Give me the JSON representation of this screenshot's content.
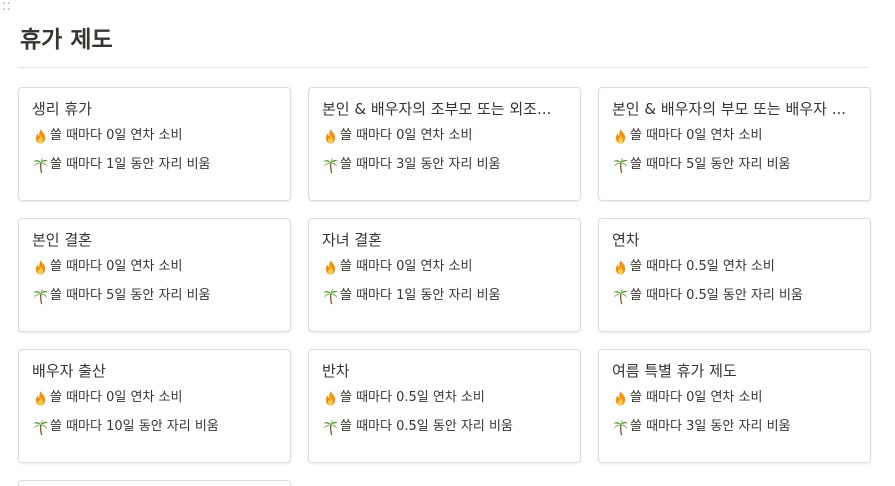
{
  "page": {
    "title": "휴가 제도"
  },
  "icons": {
    "fire": "fire-emoji-icon",
    "palm": "palm-tree-emoji-icon"
  },
  "cards": [
    {
      "title": "생리 휴가",
      "line1": "쓸 때마다 0일 연차 소비",
      "line2": "쓸 때마다 1일 동안 자리 비움"
    },
    {
      "title": "본인 & 배우자의 조부모 또는 외조...",
      "line1": "쓸 때마다 0일 연차 소비",
      "line2": "쓸 때마다 3일 동안 자리 비움"
    },
    {
      "title": "본인 & 배우자의 부모 또는 배우자 ...",
      "line1": "쓸 때마다 0일 연차 소비",
      "line2": "쓸 때마다 5일 동안 자리 비움"
    },
    {
      "title": "본인 결혼",
      "line1": "쓸 때마다 0일 연차 소비",
      "line2": "쓸 때마다 5일 동안 자리 비움"
    },
    {
      "title": "자녀 결혼",
      "line1": "쓸 때마다 0일 연차 소비",
      "line2": "쓸 때마다 1일 동안 자리 비움"
    },
    {
      "title": "연차",
      "line1": "쓸 때마다 0.5일 연차 소비",
      "line2": "쓸 때마다 0.5일 동안 자리 비움"
    },
    {
      "title": "배우자 출산",
      "line1": "쓸 때마다 0일 연차 소비",
      "line2": "쓸 때마다 10일 동안 자리 비움"
    },
    {
      "title": "반차",
      "line1": "쓸 때마다 0.5일 연차 소비",
      "line2": "쓸 때마다 0.5일 동안 자리 비움"
    },
    {
      "title": "여름 특별 휴가 제도",
      "line1": "쓸 때마다 0일 연차 소비",
      "line2": "쓸 때마다 3일 동안 자리 비움"
    }
  ]
}
